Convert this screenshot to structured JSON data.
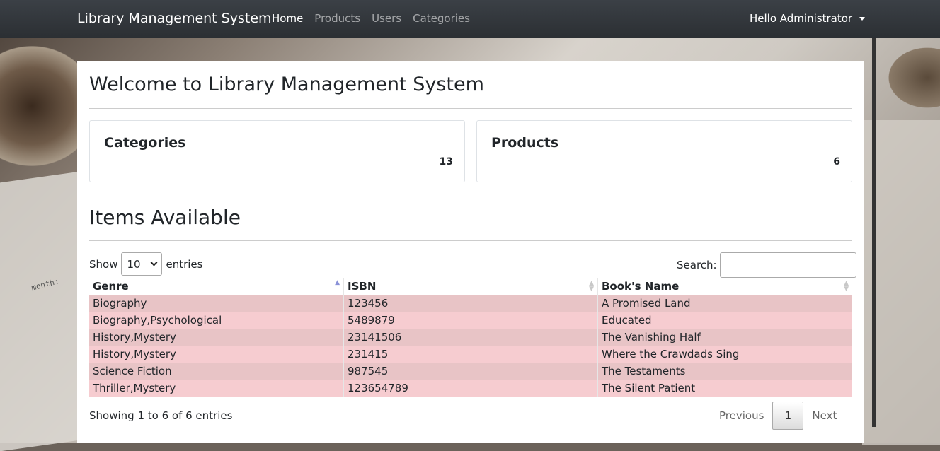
{
  "navbar": {
    "brand": "Library Management System",
    "links": [
      {
        "label": "Home",
        "active": true
      },
      {
        "label": "Products",
        "active": false
      },
      {
        "label": "Users",
        "active": false
      },
      {
        "label": "Categories",
        "active": false
      }
    ],
    "user_menu": "Hello Administrator"
  },
  "background": {
    "month_text": "month:"
  },
  "main": {
    "title": "Welcome to Library Management System",
    "stats": [
      {
        "label": "Categories",
        "value": "13"
      },
      {
        "label": "Products",
        "value": "6"
      }
    ],
    "section_title": "Items Available",
    "table_controls": {
      "show_prefix": "Show",
      "entries_value": "10",
      "show_suffix": "entries",
      "search_label": "Search:",
      "search_value": ""
    },
    "table": {
      "columns": [
        "Genre",
        "ISBN",
        "Book's Name"
      ],
      "rows": [
        [
          "Biography",
          "123456",
          "A Promised Land"
        ],
        [
          "Biography,Psychological",
          "5489879",
          "Educated"
        ],
        [
          "History,Mystery",
          "23141506",
          "The Vanishing Half"
        ],
        [
          "History,Mystery",
          "231415",
          "Where the Crawdads Sing"
        ],
        [
          "Science Fiction",
          "987545",
          "The Testaments"
        ],
        [
          "Thriller,Mystery",
          "123654789",
          "The Silent Patient"
        ]
      ]
    },
    "footer": {
      "info": "Showing 1 to 6 of 6 entries",
      "previous": "Previous",
      "page": "1",
      "next": "Next"
    }
  }
}
